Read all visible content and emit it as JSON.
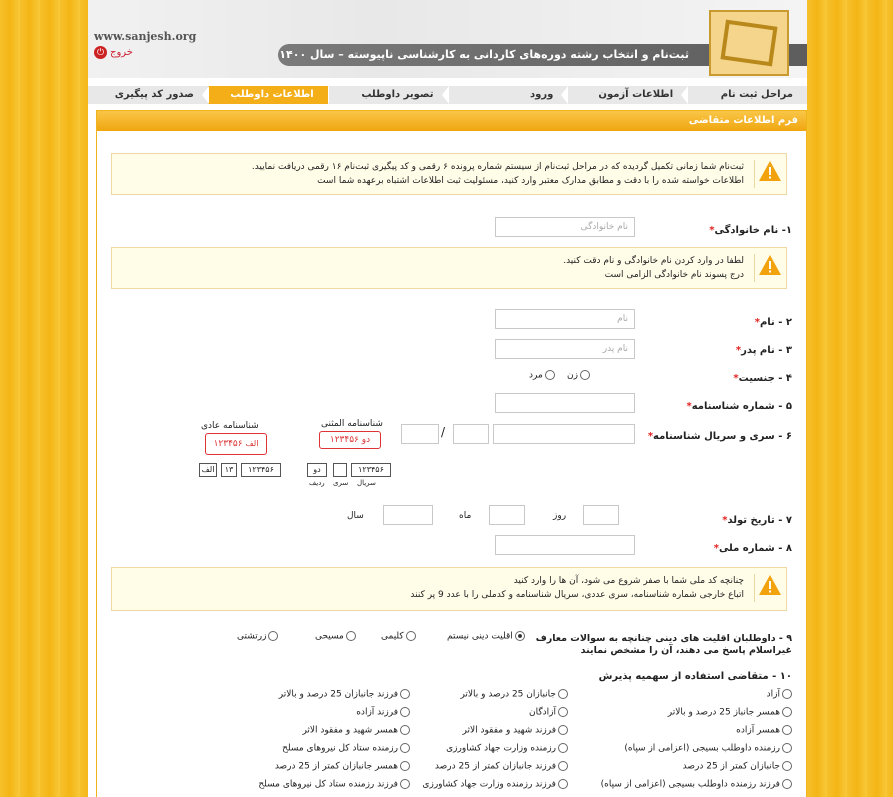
{
  "site": "www.sanjesh.org",
  "exit_label": "خروج",
  "title": "ثبت‌نام و انتخاب رشته دوره‌های کاردانی به کارشناسی ناپیوسته – سال ۱۴۰۰",
  "steps": [
    "مراحل ثبت نام",
    "اطلاعات آزمون",
    "ورود",
    "تصویر داوطلب",
    "اطلاعات داوطلب",
    "صدور کد پیگیری"
  ],
  "panel_title": "فرم اطلاعات متقاضی",
  "alert1": {
    "l1": "ثبت‌نام شما زمانی تکمیل گردیده که در مراحل ثبت‌نام از سیستم شماره پرونده ۶ رقمی و کد پیگیری ثبت‌نام ۱۶ رقمی دریافت نمایید.",
    "l2": "اطلاعات خواسته شده را با دقت و مطابق مدارک معتبر وارد کنید، مسئولیت ثبت اطلاعات اشتباه برعهده شما است"
  },
  "f1": {
    "label": "۱- نام خانوادگی",
    "ph": "نام خانوادگی"
  },
  "alert2": {
    "l1": "لطفا در وارد کردن نام خانوادگی و نام دقت کنید.",
    "l2": "درج پسوند نام خانوادگی الزامی است"
  },
  "f2": {
    "label": "۲ - نام",
    "ph": "نام"
  },
  "f3": {
    "label": "۳ - نام پدر",
    "ph": "نام پدر"
  },
  "f4": {
    "label": "۴ - جنسیت",
    "female": "زن",
    "male": "مرد"
  },
  "f5": {
    "label": "۵ - شماره شناسنامه"
  },
  "f6": {
    "label": "۶ - سری و سریال شناسنامه",
    "slash": "/",
    "smart": "شناسنامه المثنی",
    "normal": "شناسنامه عادی",
    "c1": "دو ۱۲۳۴۵۶",
    "c2": "۱۲۳۴۵۶",
    "c2top": "الف",
    "c2bot": "۱۳",
    "s1": "۱۲۳۴۵۶",
    "s2": "دو",
    "s3": "۱۲۳۴۵۶",
    "s4": "۱۳",
    "s5": "الف",
    "lb_serial": "سریال",
    "lb_seri": "سری",
    "lb_radif": "ردیف"
  },
  "f7": {
    "label": "۷ - تاریخ تولد",
    "day": "روز",
    "month": "ماه",
    "year": "سال"
  },
  "f8": {
    "label": "۸ - شماره ملی"
  },
  "alert3": {
    "l1": "چنانچه کد ملی شما با صفر شروع می شود، آن ها را وارد کنید",
    "l2": "اتباع خارجی شماره شناسنامه، سری عددی، سریال شناسنامه و کدملی را با عدد 9 پر کنند"
  },
  "f9": {
    "label1": "۹ - داوطلبان اقلیت های دینی چنانچه به سوالات معارف",
    "label2": "غیراسلام پاسخ می دهند، آن را مشخص نمایند",
    "opts": [
      "اقلیت دینی نیستم",
      "کلیمی",
      "مسیحی",
      "زرتشتی"
    ]
  },
  "f10": {
    "label": "۱۰ - متقاضی استفاده از سهمیه پذیرش",
    "col1": [
      "آزاد",
      "همسر جانباز 25 درصد و بالاتر",
      "همسر آزاده",
      "رزمنده داوطلب بسیجی (اعزامی از سپاه)",
      "جانبازان کمتر از 25 درصد",
      "فرزند رزمنده داوطلب بسیجی (اعزامی از سپاه)"
    ],
    "col2": [
      "جانبازان 25 درصد و بالاتر",
      "آزادگان",
      "فرزند شهید و مفقود الاثر",
      "رزمنده وزارت جهاد کشاورزی",
      "فرزند جانبازان کمتر از 25 درصد",
      "فرزند رزمنده وزارت جهاد کشاورزی"
    ],
    "col3": [
      "فرزند جانبازان 25 درصد و بالاتر",
      "فرزند آزاده",
      "همسر شهید و مفقود الاثر",
      "رزمنده ستاد کل نیروهای مسلح",
      "همسر جانبازان کمتر از 25 درصد",
      "فرزند رزمنده ستاد کل نیروهای مسلح"
    ]
  }
}
